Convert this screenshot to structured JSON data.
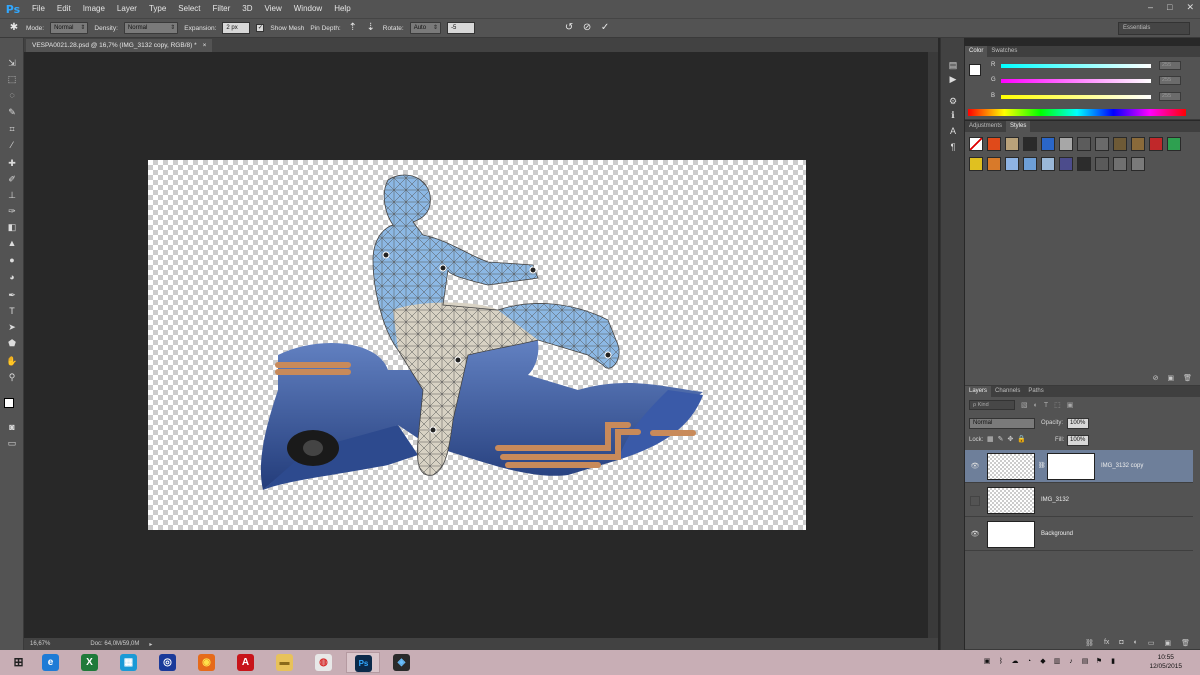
{
  "app": {
    "logo": "Ps"
  },
  "menu": [
    "File",
    "Edit",
    "Image",
    "Layer",
    "Type",
    "Select",
    "Filter",
    "3D",
    "View",
    "Window",
    "Help"
  ],
  "window_controls": {
    "minimize": "–",
    "maximize": "□",
    "close": "✕"
  },
  "options_bar": {
    "mode_label": "Mode:",
    "mode_value": "Normal",
    "density_label": "Density:",
    "density_value": "Normal",
    "expansion_label": "Expansion:",
    "expansion_value": "2 px",
    "show_mesh_label": "Show Mesh",
    "pin_depth_label": "Pin Depth:",
    "rotate_label": "Rotate:",
    "rotate_value": "Auto",
    "rotate_angle": "-5",
    "workspace": "Essentials"
  },
  "document": {
    "tab_title": "VESPA0021.28.psd @ 16,7% (IMG_3132 copy, RGB/8) *",
    "close_glyph": "×"
  },
  "status": {
    "zoom": "16,67%",
    "doc": "Doc: 64,0M/59,0M"
  },
  "color_panel": {
    "tabs": [
      "Color",
      "Swatches"
    ],
    "channels": [
      {
        "label": "R",
        "value": "255",
        "gradient": "linear-gradient(90deg,#00ffff,#ffffff)"
      },
      {
        "label": "G",
        "value": "255",
        "gradient": "linear-gradient(90deg,#ff00ff,#ffffff)"
      },
      {
        "label": "B",
        "value": "255",
        "gradient": "linear-gradient(90deg,#ffff00,#ffffff)"
      }
    ]
  },
  "styles_panel": {
    "tabs": [
      "Adjustments",
      "Styles"
    ],
    "swatches_row1": [
      "#ffffff",
      "#e04a1a",
      "#b9a27a",
      "#2a2a2a",
      "#2a66c8",
      "#a7a7a7",
      "#5c5c5c",
      "#6a6a6a",
      "#6e5a36",
      "#8a6a3a",
      "#c0282a",
      "#2ea050"
    ],
    "swatches_row2": [
      "#e0c020",
      "#d87a2a",
      "#8fb4e4",
      "#6ea0d8",
      "#9ab8d8",
      "#4c4c8c",
      "#2c2c2c",
      "#5a5a5a",
      "#707070",
      "#7a7a7a"
    ]
  },
  "layers_panel": {
    "tabs": [
      "Layers",
      "Channels",
      "Paths"
    ],
    "filter_kind": "ρ Kind",
    "blend_mode": "Normal",
    "opacity_label": "Opacity:",
    "opacity_value": "100%",
    "lock_label": "Lock:",
    "fill_label": "Fill:",
    "fill_value": "100%",
    "layers": [
      {
        "name": "IMG_3132 copy",
        "visible": true,
        "selected": true,
        "has_mask": true
      },
      {
        "name": "IMG_3132",
        "visible": false,
        "selected": false,
        "has_mask": false
      },
      {
        "name": "Background",
        "visible": true,
        "selected": false,
        "has_mask": false
      }
    ]
  },
  "taskbar": {
    "time": "10:55",
    "date": "12/05/2015",
    "apps": [
      {
        "name": "ie",
        "glyph": "e",
        "color": "#1e7bd6",
        "text": "#ffffff"
      },
      {
        "name": "excel",
        "glyph": "X",
        "color": "#1f7a3a",
        "text": "#ffffff"
      },
      {
        "name": "store",
        "glyph": "▦",
        "color": "#1a9ad6",
        "text": "#ffffff"
      },
      {
        "name": "vpn",
        "glyph": "◎",
        "color": "#1a3a9a",
        "text": "#ffffff"
      },
      {
        "name": "firefox",
        "glyph": "◉",
        "color": "#e66a1a",
        "text": "#ffe14a"
      },
      {
        "name": "acrobat",
        "glyph": "A",
        "color": "#c8141a",
        "text": "#ffffff"
      },
      {
        "name": "explorer",
        "glyph": "▬",
        "color": "#e8c25a",
        "text": "#8a6a1a"
      },
      {
        "name": "chrome",
        "glyph": "◍",
        "color": "#e8e8e8",
        "text": "#d82a2a"
      },
      {
        "name": "photoshop",
        "glyph": "Ps",
        "color": "#0b2a4a",
        "text": "#31a8ff"
      },
      {
        "name": "camera",
        "glyph": "◈",
        "color": "#2a2a2a",
        "text": "#6ac0ff"
      }
    ]
  }
}
